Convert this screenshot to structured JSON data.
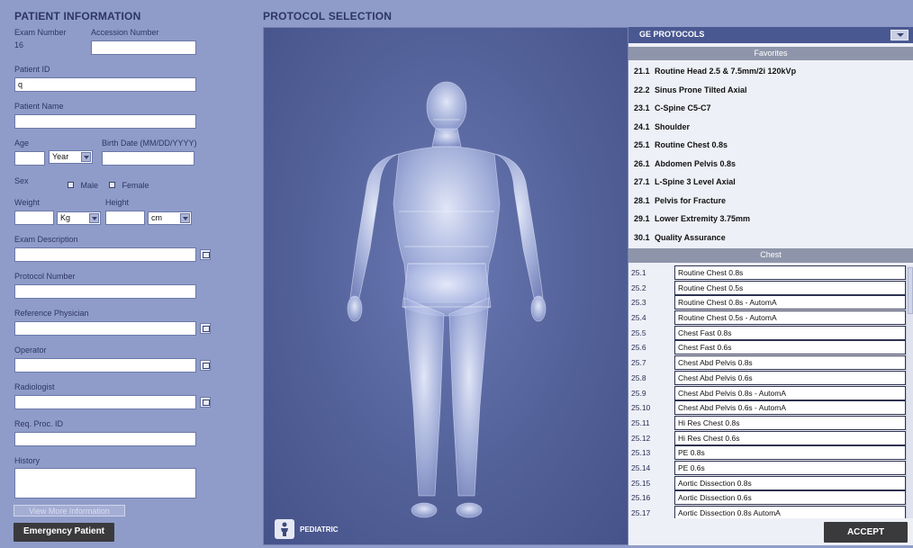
{
  "patient_info": {
    "header": "PATIENT INFORMATION",
    "exam_number_label": "Exam Number",
    "exam_number_value": "16",
    "accession_number_label": "Accession Number",
    "accession_number_value": "",
    "patient_id_label": "Patient ID",
    "patient_id_value": "q",
    "patient_name_label": "Patient Name",
    "patient_name_value": "",
    "age_label": "Age",
    "age_value": "",
    "age_unit": "Year",
    "birth_date_label": "Birth Date (MM/DD/YYYY)",
    "birth_date_value": "",
    "sex_label": "Sex",
    "sex_male": "Male",
    "sex_female": "Female",
    "weight_label": "Weight",
    "weight_value": "",
    "weight_unit": "Kg",
    "height_label": "Height",
    "height_value": "",
    "height_unit": "cm",
    "exam_description_label": "Exam Description",
    "protocol_number_label": "Protocol Number",
    "reference_physician_label": "Reference Physician",
    "operator_label": "Operator",
    "radiologist_label": "Radiologist",
    "req_proc_id_label": "Req. Proc. ID",
    "history_label": "History",
    "view_more_label": "View More Information",
    "emergency_label": "Emergency Patient"
  },
  "protocol": {
    "header": "PROTOCOL SELECTION",
    "pediatric_label": "PEDIATRIC",
    "protocol_set": "GE PROTOCOLS",
    "favorites_title": "Favorites",
    "favorites": [
      {
        "num": "21.1",
        "name": "Routine Head 2.5 & 7.5mm/2i 120kVp"
      },
      {
        "num": "22.2",
        "name": "Sinus Prone Tilted Axial"
      },
      {
        "num": "23.1",
        "name": "C-Spine C5-C7"
      },
      {
        "num": "24.1",
        "name": "Shoulder"
      },
      {
        "num": "25.1",
        "name": "Routine Chest 0.8s"
      },
      {
        "num": "26.1",
        "name": "Abdomen Pelvis 0.8s"
      },
      {
        "num": "27.1",
        "name": "L-Spine 3 Level Axial"
      },
      {
        "num": "28.1",
        "name": "Pelvis for Fracture"
      },
      {
        "num": "29.1",
        "name": "Lower Extremity 3.75mm"
      },
      {
        "num": "30.1",
        "name": "Quality Assurance"
      }
    ],
    "chest_title": "Chest",
    "chest": [
      {
        "num": "25.1",
        "name": "Routine Chest 0.8s"
      },
      {
        "num": "25.2",
        "name": "Routine Chest 0.5s"
      },
      {
        "num": "25.3",
        "name": "Routine Chest 0.8s - AutomA"
      },
      {
        "num": "25.4",
        "name": "Routine Chest 0.5s - AutomA"
      },
      {
        "num": "25.5",
        "name": "Chest Fast 0.8s"
      },
      {
        "num": "25.6",
        "name": "Chest Fast 0.6s"
      },
      {
        "num": "25.7",
        "name": "Chest Abd Pelvis 0.8s"
      },
      {
        "num": "25.8",
        "name": "Chest Abd Pelvis 0.6s"
      },
      {
        "num": "25.9",
        "name": "Chest Abd Pelvis 0.8s - AutomA"
      },
      {
        "num": "25.10",
        "name": "Chest Abd Pelvis 0.6s - AutomA"
      },
      {
        "num": "25.11",
        "name": "Hi Res Chest 0.8s"
      },
      {
        "num": "25.12",
        "name": "Hi Res Chest 0.6s"
      },
      {
        "num": "25.13",
        "name": "PE 0.8s"
      },
      {
        "num": "25.14",
        "name": "PE 0.6s"
      },
      {
        "num": "25.15",
        "name": "Aortic Dissection 0.8s"
      },
      {
        "num": "25.16",
        "name": "Aortic Dissection 0.6s"
      },
      {
        "num": "25.17",
        "name": "Aortic Dissection 0.8s AutomA"
      }
    ],
    "accept_label": "ACCEPT"
  }
}
